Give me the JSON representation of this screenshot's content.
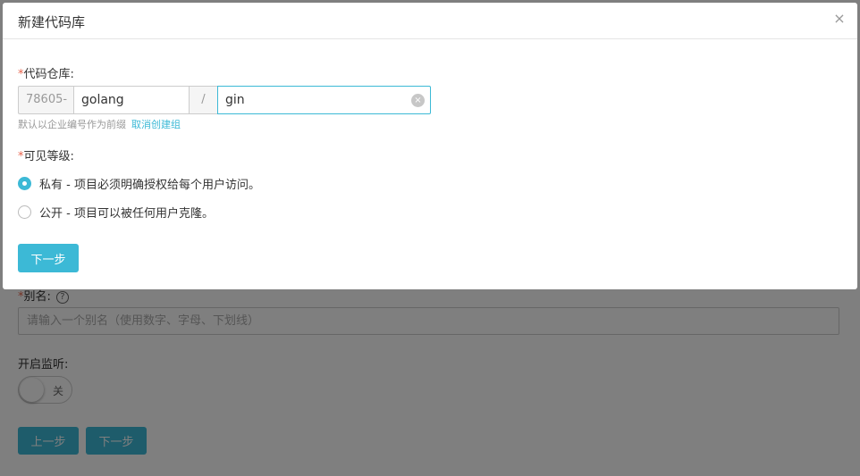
{
  "background_form": {
    "alias_label": "别名:",
    "alias_required_mark": "*",
    "alias_help": "?",
    "alias_placeholder": "请输入一个别名（使用数字、字母、下划线）",
    "listen_label": "开启监听:",
    "toggle_state_label": "关",
    "prev_button": "上一步",
    "next_button": "下一步"
  },
  "modal": {
    "title": "新建代码库",
    "close_glyph": "×",
    "repo_field": {
      "required_mark": "*",
      "label": "代码仓库:",
      "prefix": "78605-",
      "group_value": "golang",
      "separator": "/",
      "name_value": "gin",
      "clear_glyph": "×",
      "hint": "默认以企业编号作为前缀",
      "hint_link": "取消创建组"
    },
    "visibility_field": {
      "required_mark": "*",
      "label": "可见等级:",
      "options": [
        {
          "label": "私有 - 项目必须明确授权给每个用户访问。",
          "checked": true
        },
        {
          "label": "公开 - 项目可以被任何用户克隆。",
          "checked": false
        }
      ]
    },
    "next_button": "下一步"
  },
  "colors": {
    "accent": "#3cb9d6",
    "required": "#e8654d",
    "overlay": "#000000"
  }
}
